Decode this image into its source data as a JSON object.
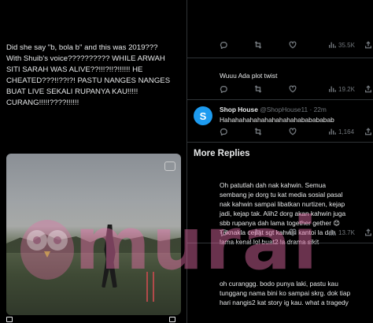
{
  "left_tweet": {
    "text": "Did she say \"b, bola b\" and this was 2019???\nWith Shuib's voice?????????? WHILE ARWAH\nSITI SARAH WAS ALIVE??!!!?!!?!!!!!! HE\nCHEATED???!!??!?! PASTU NANGES NANGES\nBUAT LIVE SEKALI RUPANYA KAU!!!!!\nCURANG!!!!!????!!!!!!"
  },
  "top_actions": {
    "views": "35.5K"
  },
  "replies": [
    {
      "text": "Wuuu Ada plot twist",
      "views": "19.2K"
    },
    {
      "name": "Shop House",
      "handle": "@ShopHouse11",
      "time": "· 22m",
      "avatar_letter": "S",
      "text": "Hahahahahahahahahahahababababab",
      "views": "1,164"
    }
  ],
  "section_title": "More Replies",
  "more_replies": [
    {
      "text": "Oh patutlah dah nak kahwin. Semua\nsembang je dorg tu kat media sosial pasal\nnak kahwin sampai libatkan nurtizen, kejap\njadi, kejap tak. Alih2 dorg akan kahwin juga\nsbb rupanya dah lama together gether 😊\nTaknakla cepat sgt kahwin kantoi la dah\nlama kenal lol buat2 la drama sikit",
      "views": "13.7K"
    },
    {
      "text": "oh curanggg. bodo punya laki, pastu kau\ntunggang nama bini ko sampai skrg. dok tiap\nhari nangis2 kat story ig kau. what a tragedy"
    }
  ],
  "watermark": {
    "text": "murai"
  },
  "colors": {
    "background": "#000000",
    "text": "#e7e9ea",
    "muted": "#71767b",
    "accent": "#1d9bf0",
    "divider": "#2f3336",
    "watermark": "#e86eaa"
  },
  "icons": [
    "reply-icon",
    "retweet-icon",
    "like-icon",
    "views-icon",
    "share-icon"
  ]
}
